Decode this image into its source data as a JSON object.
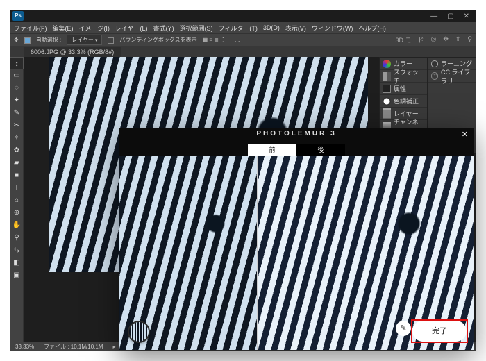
{
  "window": {
    "app_badge": "Ps",
    "min": "—",
    "max": "▢",
    "close": "✕"
  },
  "menu": [
    "ファイル(F)",
    "編集(E)",
    "イメージ(I)",
    "レイヤー(L)",
    "書式(Y)",
    "選択範囲(S)",
    "フィルター(T)",
    "3D(D)",
    "表示(V)",
    "ウィンドウ(W)",
    "ヘルプ(H)"
  ],
  "options": {
    "auto_select_label": "自動選択 :",
    "layer_select": "レイヤー",
    "show_bbox_label": "バウンディングボックスを表示",
    "threed_mode": "3D モード"
  },
  "doc_tab": "6006.JPG @ 33.3% (RGB/8#)",
  "tools": [
    "↕",
    "▭",
    "◌",
    "✦",
    "✎",
    "✂",
    "✧",
    "✿",
    "▰",
    "■",
    "T",
    "⌂",
    "⊕",
    "✋",
    "⚲",
    "⇆",
    "◧",
    "▣"
  ],
  "panels_left": [
    {
      "icon": "ic-color",
      "label": "カラー"
    },
    {
      "icon": "ic-swatch",
      "label": "スウォッチ"
    },
    {
      "icon": "ic-prop",
      "label": "属性"
    },
    {
      "icon": "ic-adjust",
      "label": "色調補正"
    },
    {
      "icon": "ic-layer",
      "label": "レイヤー"
    },
    {
      "icon": "ic-chan",
      "label": "チャンネル"
    }
  ],
  "panels_right": [
    {
      "kind": "bulb",
      "label": "ラーニング"
    },
    {
      "kind": "cc",
      "label": "CC ライブラリ"
    }
  ],
  "status": {
    "zoom": "33.33%",
    "file": "ファイル : 10.1M/10.1M"
  },
  "photolemur": {
    "title": "PHOTOLEMUR 3",
    "close": "✕",
    "tab_before": "前",
    "tab_after": "後",
    "pencil": "✎",
    "done": "完了"
  }
}
